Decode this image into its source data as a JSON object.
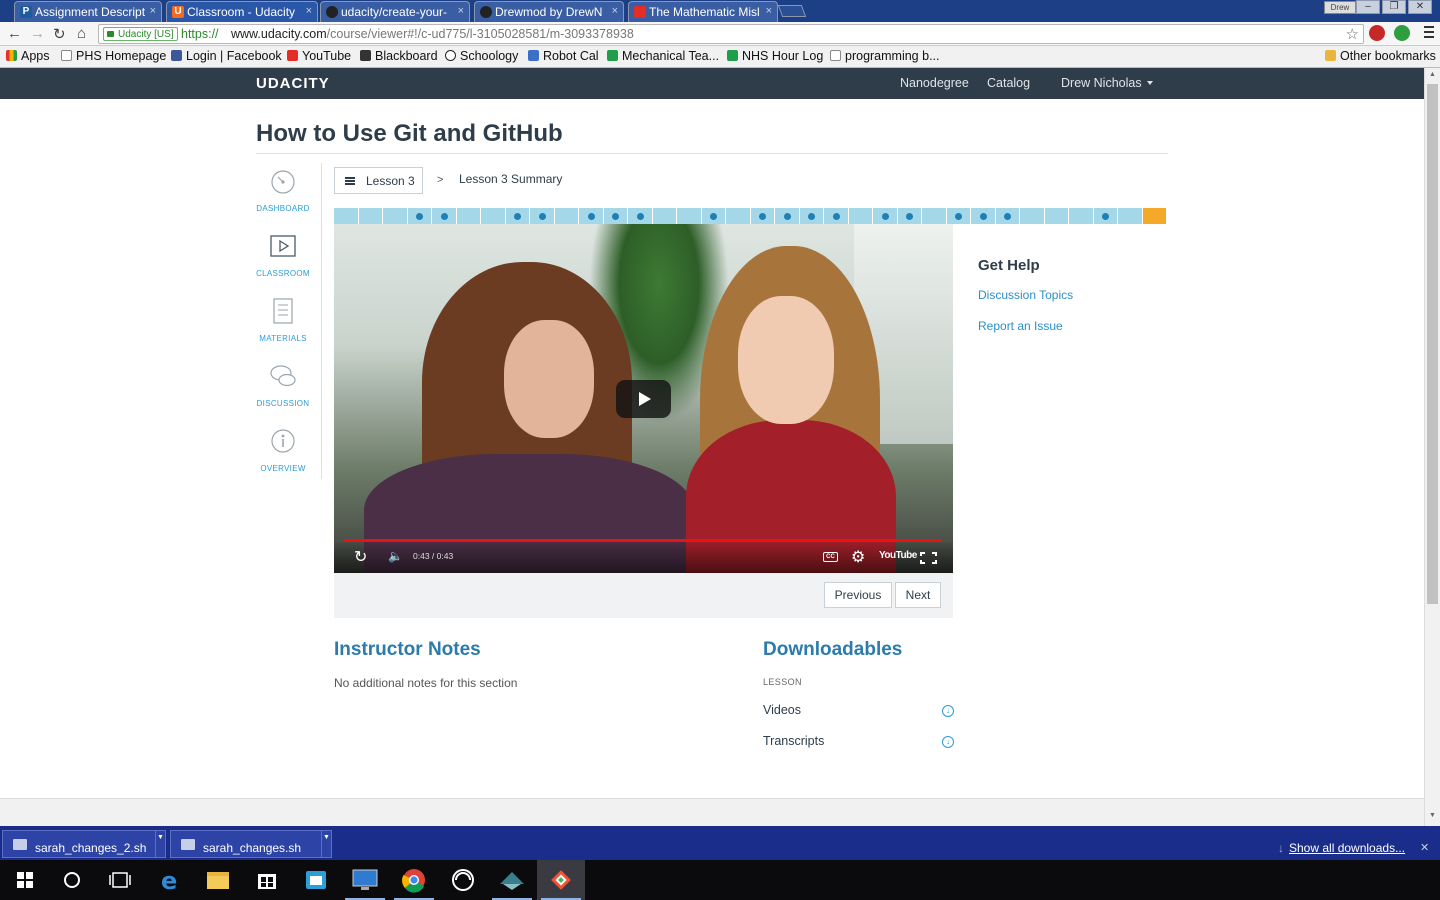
{
  "browser": {
    "tabs": [
      {
        "title": "Assignment Descript",
        "icon": "P",
        "icon_color": "#1d5a9e"
      },
      {
        "title": "Classroom - Udacity",
        "icon": "U",
        "icon_color": "#f26b22"
      },
      {
        "title": "udacity/create-your-",
        "icon": "github-icon",
        "icon_color": "#222222"
      },
      {
        "title": "Drewmod by DrewN",
        "icon": "github-icon",
        "icon_color": "#222222"
      },
      {
        "title": "The Mathematic Misl",
        "icon": "youtube-icon",
        "icon_color": "#e52d27"
      }
    ],
    "user_badge": "Drew",
    "window_controls": [
      "–",
      "❐",
      "✕"
    ],
    "address": {
      "ev_label": "Udacity [US]",
      "scheme": "https://",
      "host": "www.udacity.com",
      "path": "/course/viewer#!/c-ud775/l-3105028581/m-3093378938"
    },
    "bookmarks": [
      {
        "label": "Apps",
        "icon": "apps-grid-icon",
        "color": "#e4332d"
      },
      {
        "label": "PHS Homepage",
        "icon": "page-icon",
        "color": "#ffffff"
      },
      {
        "label": "Login | Facebook",
        "icon": "facebook-icon",
        "color": "#3b5998"
      },
      {
        "label": "YouTube",
        "icon": "youtube-icon",
        "color": "#e52d27"
      },
      {
        "label": "Blackboard",
        "icon": "blackboard-icon",
        "color": "#333333"
      },
      {
        "label": "Schoology",
        "icon": "schoology-icon",
        "color": "#222222"
      },
      {
        "label": "Robot Cal",
        "icon": "calendar-icon",
        "color": "#3a70c9"
      },
      {
        "label": "Mechanical Tea...",
        "icon": "sheets-icon",
        "color": "#1e9e4a"
      },
      {
        "label": "NHS Hour Log",
        "icon": "sheets-icon",
        "color": "#1e9e4a"
      },
      {
        "label": "programming b...",
        "icon": "page-icon",
        "color": "#ffffff"
      }
    ],
    "other_bookmarks": "Other bookmarks"
  },
  "site": {
    "logo": "UDACITY",
    "nav": [
      "Nanodegree",
      "Catalog",
      "Drew Nicholas"
    ]
  },
  "course": {
    "title": "How to Use Git and GitHub",
    "sidebar": [
      {
        "label": "DASHBOARD",
        "icon": "dashboard-gauge-icon"
      },
      {
        "label": "CLASSROOM",
        "icon": "play-screen-icon"
      },
      {
        "label": "MATERIALS",
        "icon": "document-icon"
      },
      {
        "label": "DISCUSSION",
        "icon": "chat-bubbles-icon"
      },
      {
        "label": "OVERVIEW",
        "icon": "info-circle-icon"
      }
    ],
    "breadcrumb": {
      "lesson": "Lesson 3",
      "separator": ">",
      "current": "Lesson 3 Summary"
    },
    "progress": {
      "segments": 34,
      "quiz_segments": [
        4,
        5,
        8,
        9,
        11,
        12,
        13,
        16,
        18,
        19,
        20,
        21,
        23,
        24,
        26,
        27,
        28,
        32
      ],
      "current_segment": 34,
      "colors": {
        "done": "#a4d8e9",
        "dot": "#1f80b6",
        "current": "#f6a829"
      }
    },
    "video": {
      "time": "0:43 / 0:43",
      "progress": 1.0,
      "youtube_label": "YouTube",
      "cc_label": "CC"
    },
    "buttons": {
      "previous": "Previous",
      "next": "Next"
    },
    "help": {
      "title": "Get Help",
      "links": [
        "Discussion Topics",
        "Report an Issue"
      ]
    },
    "instructor_notes": {
      "title": "Instructor Notes",
      "text": "No additional notes for this section"
    },
    "downloadables": {
      "title": "Downloadables",
      "subtitle": "LESSON",
      "items": [
        "Videos",
        "Transcripts"
      ]
    }
  },
  "download_shelf": {
    "files": [
      "sarah_changes_2.sh",
      "sarah_changes.sh"
    ],
    "show_all": "Show all downloads..."
  },
  "taskbar": {
    "apps": [
      "start-icon",
      "cortana-icon",
      "task-view-icon",
      "edge-icon",
      "file-explorer-icon",
      "store-icon",
      "outlook-icon",
      "remote-desktop-icon",
      "chrome-icon",
      "groove-icon",
      "git-cola-icon",
      "git-gui-icon"
    ]
  }
}
